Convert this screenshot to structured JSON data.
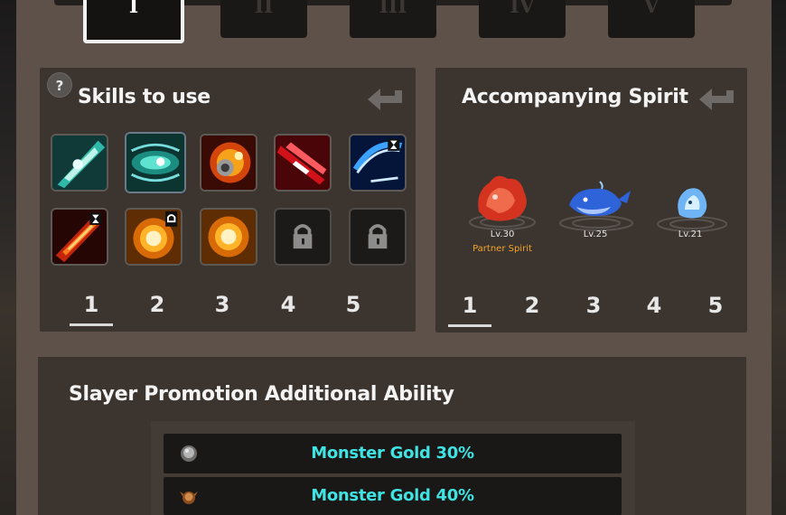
{
  "tabs": [
    {
      "label": "I",
      "active": true
    },
    {
      "label": "II",
      "active": false
    },
    {
      "label": "III",
      "active": false
    },
    {
      "label": "IV",
      "active": false
    },
    {
      "label": "V",
      "active": false
    }
  ],
  "skills_panel": {
    "help_label": "?",
    "title": "Skills to use",
    "slot_numbers": [
      "1",
      "2",
      "3",
      "4",
      "5"
    ],
    "selected_slot": 1,
    "skills_row1": [
      "cyan-blade-skill-icon",
      "cyan-vortex-skill-icon",
      "fire-gear-skill-icon",
      "red-slash-skill-icon",
      "blue-arc-skill-icon"
    ],
    "skills_row2": [
      "flame-sword-skill-icon",
      "golden-orb-skill-icon",
      "golden-orb-skill-icon",
      "lock-icon",
      "lock-icon"
    ]
  },
  "spirit_panel": {
    "title": "Accompanying Spirit",
    "slot_numbers": [
      "1",
      "2",
      "3",
      "4",
      "5"
    ],
    "selected_slot": 1,
    "spirits": [
      {
        "name": "red-spirit",
        "level": "Lv.30",
        "tag": "Partner Spirit"
      },
      {
        "name": "blue-whale-spirit",
        "level": "Lv.25",
        "tag": ""
      },
      {
        "name": "ice-spirit",
        "level": "Lv.21",
        "tag": ""
      }
    ]
  },
  "promotion": {
    "title": "Slayer Promotion Additional Ability",
    "abilities": [
      {
        "icon": "silver-rank-icon",
        "text": "Monster Gold 30%"
      },
      {
        "icon": "bronze-winged-rank-icon",
        "text": "Monster Gold 40%"
      }
    ]
  },
  "colors": {
    "panel": "#5e5149",
    "box": "#3b342f",
    "ability_text": "#40e2e2",
    "partner_label": "#f0a52a"
  }
}
